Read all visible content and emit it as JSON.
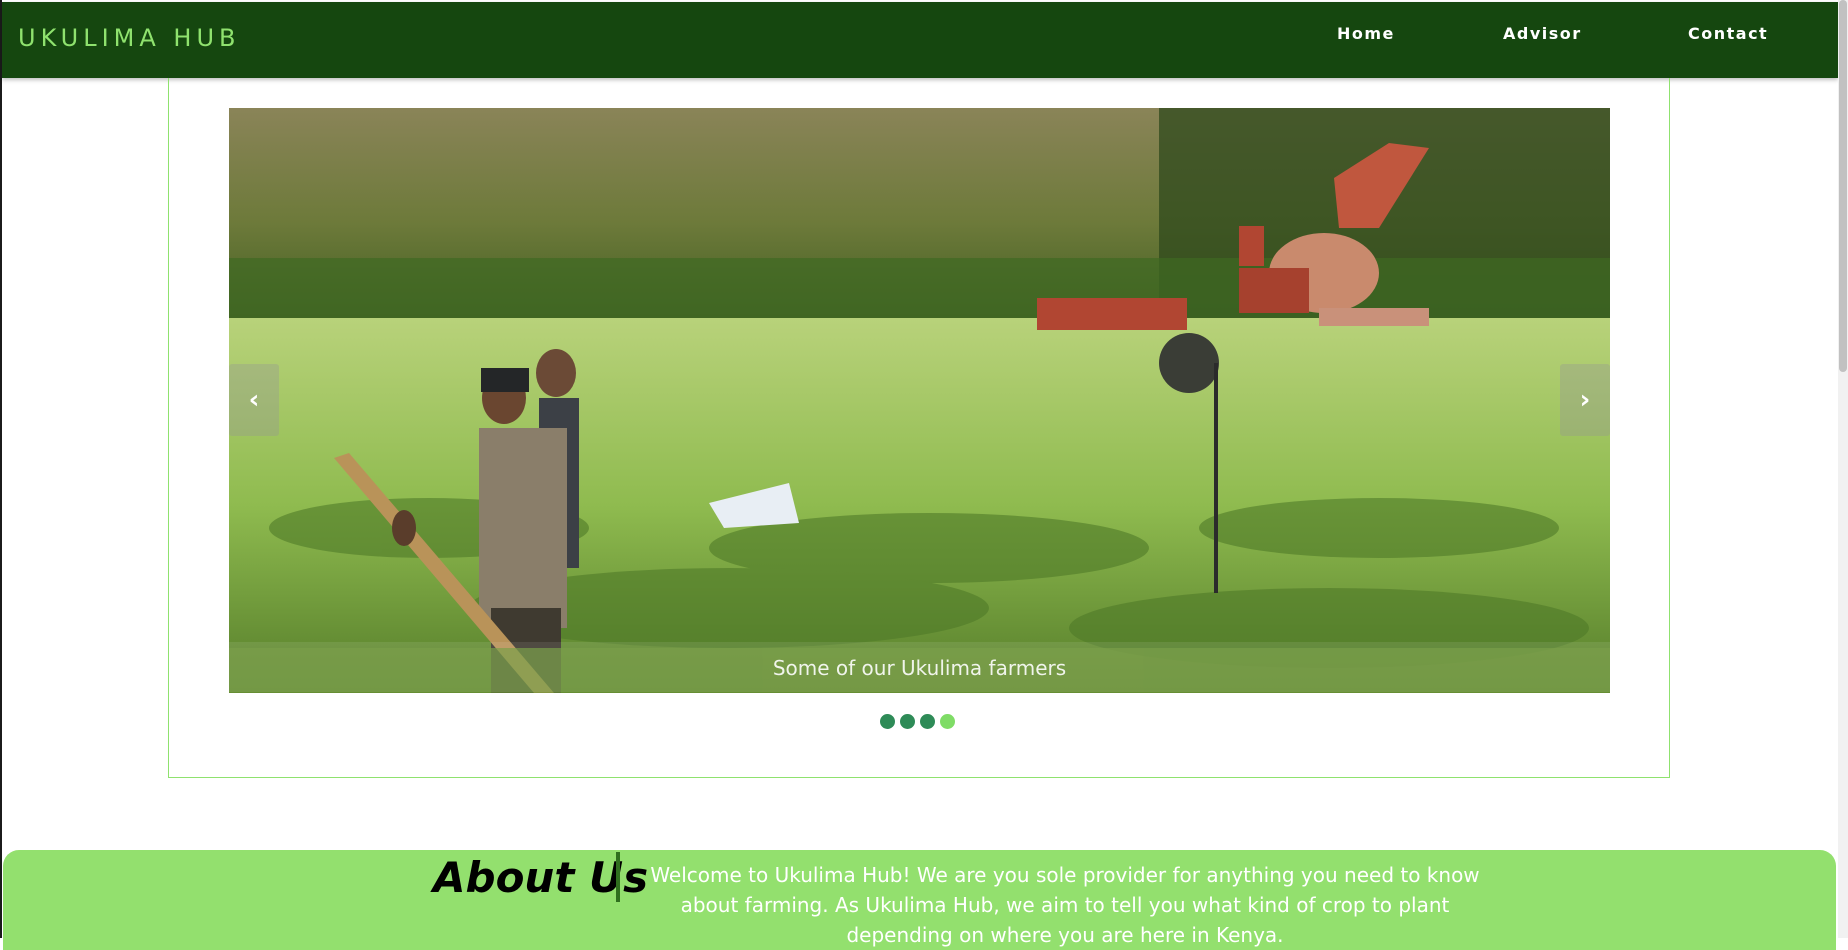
{
  "nav": {
    "brand": "UKULIMA HUB",
    "links": [
      "Home",
      "Advisor",
      "Contact"
    ]
  },
  "carousel": {
    "caption": "Some of our Ukulima farmers",
    "prev_icon": "chevron-left",
    "next_icon": "chevron-right",
    "slide_count": 4,
    "active_index": 3,
    "image": "farmers working in a grass field with a red tractor"
  },
  "about": {
    "title": "About Us",
    "text": "Welcome to Ukulima Hub! We are you sole provider for anything you need to know about farming. As Ukulima Hub, we aim to tell you what kind of crop to plant depending on where you are here in Kenya."
  },
  "colors": {
    "navbar": "#15470f",
    "brand": "#8fe26e",
    "about_bg": "#93e06e",
    "dot": "#2e8b57",
    "dot_active": "#7fdc66"
  }
}
